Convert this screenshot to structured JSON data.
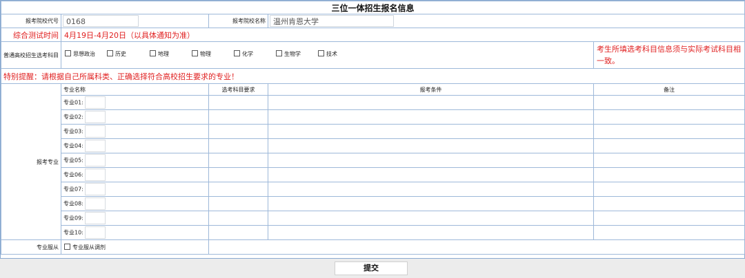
{
  "title": "三位一体招生报名信息",
  "school": {
    "code_label": "报考院校代号",
    "code_value": "0168",
    "name_label": "报考院校名称",
    "name_value": "温州肯恩大学"
  },
  "test": {
    "label": "综合测试时间",
    "value": "4月19日-4月20日（以具体通知为准）"
  },
  "subjects": {
    "label": "普通高校招生选考科目",
    "items": [
      "思想政治",
      "历史",
      "地理",
      "物理",
      "化学",
      "生物学",
      "技术"
    ],
    "note": "考生所填选考科目信息须与实际考试科目相一致。"
  },
  "warning": "特别提醒：请根据自己所属科类、正确选择符合高校招生要求的专业！",
  "majors": {
    "section_label": "报考专业",
    "headers": {
      "name": "专业名称",
      "subject_req": "选考科目要求",
      "condition": "报考条件",
      "remark": "备注"
    },
    "rows": [
      "专业01:",
      "专业02:",
      "专业03:",
      "专业04:",
      "专业05:",
      "专业06:",
      "专业07:",
      "专业08:",
      "专业09:",
      "专业10:"
    ]
  },
  "obey": {
    "label": "专业服从",
    "checkbox_label": "专业服从调剂"
  },
  "submit_label": "提交",
  "colors": {
    "border": "#9db8d9",
    "warning_red": "#e02020",
    "background": "#ececec"
  }
}
